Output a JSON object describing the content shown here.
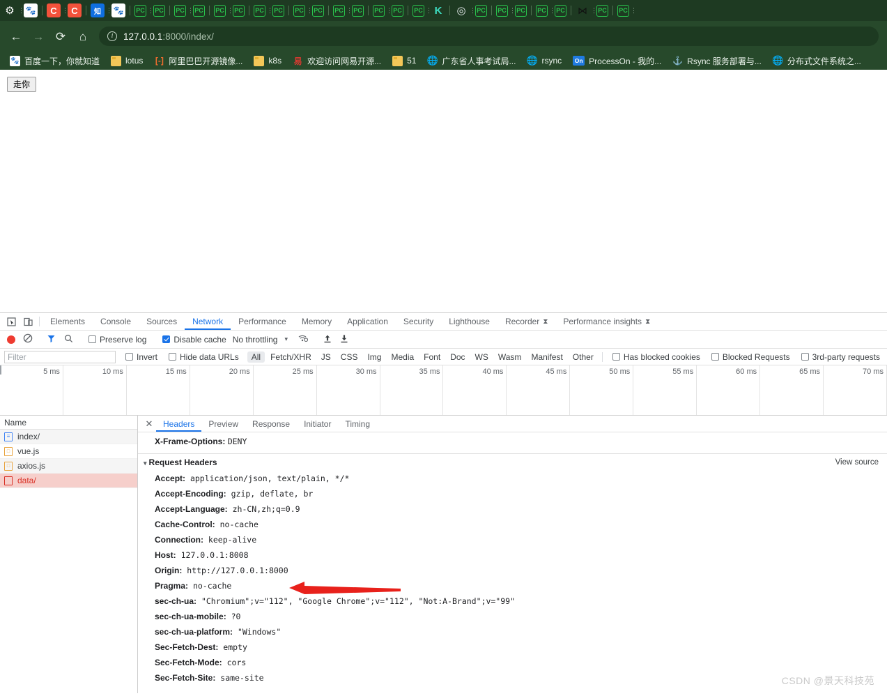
{
  "browser": {
    "tabs": [
      {
        "icon": "gear-icon",
        "glyph": "⚙",
        "cls": "ico-gear"
      },
      {
        "icon": "baidu-icon",
        "glyph": "🐾",
        "cls": "ico-baidu"
      },
      {
        "icon": "csdn-icon",
        "glyph": "C",
        "cls": "ico-c"
      },
      {
        "icon": "csdn-icon",
        "glyph": "C",
        "cls": "ico-c"
      },
      {
        "icon": "zhihu-icon",
        "glyph": "知",
        "cls": "ico-zhi"
      },
      {
        "icon": "baidu-icon",
        "glyph": "🐾",
        "cls": "ico-baidu"
      },
      {
        "icon": "pycharm-icon",
        "glyph": "PC",
        "cls": "ico-pc"
      },
      {
        "icon": "pycharm-icon",
        "glyph": "PC",
        "cls": "ico-pc"
      },
      {
        "icon": "pycharm-icon",
        "glyph": "PC",
        "cls": "ico-pc"
      },
      {
        "icon": "pycharm-icon",
        "glyph": "PC",
        "cls": "ico-pc"
      },
      {
        "icon": "pycharm-icon",
        "glyph": "PC",
        "cls": "ico-pc"
      },
      {
        "icon": "pycharm-icon",
        "glyph": "PC",
        "cls": "ico-pc"
      },
      {
        "icon": "pycharm-icon",
        "glyph": "PC",
        "cls": "ico-pc"
      },
      {
        "icon": "pycharm-icon",
        "glyph": "PC",
        "cls": "ico-pc"
      },
      {
        "icon": "pycharm-icon",
        "glyph": "PC",
        "cls": "ico-pc"
      },
      {
        "icon": "pycharm-icon",
        "glyph": "PC",
        "cls": "ico-pc"
      },
      {
        "icon": "pycharm-icon",
        "glyph": "PC",
        "cls": "ico-pc"
      },
      {
        "icon": "pycharm-icon",
        "glyph": "PC",
        "cls": "ico-pc"
      },
      {
        "icon": "pycharm-icon",
        "glyph": "PC",
        "cls": "ico-pc"
      },
      {
        "icon": "pycharm-icon",
        "glyph": "PC",
        "cls": "ico-pc"
      },
      {
        "icon": "pycharm-icon",
        "glyph": "PC",
        "cls": "ico-pc"
      },
      {
        "icon": "kafka-icon",
        "glyph": "K",
        "cls": "ico-k"
      },
      {
        "icon": "chrome-icon",
        "glyph": "◎",
        "cls": "ico-chrome"
      },
      {
        "icon": "pycharm-icon",
        "glyph": "PC",
        "cls": "ico-pc"
      },
      {
        "icon": "pycharm-icon",
        "glyph": "PC",
        "cls": "ico-pc"
      },
      {
        "icon": "pycharm-icon",
        "glyph": "PC",
        "cls": "ico-pc"
      },
      {
        "icon": "pycharm-icon",
        "glyph": "PC",
        "cls": "ico-pc"
      },
      {
        "icon": "pycharm-icon",
        "glyph": "PC",
        "cls": "ico-pc"
      },
      {
        "icon": "bowtie-icon",
        "glyph": "⋈",
        "cls": "ico-bow"
      },
      {
        "icon": "pycharm-icon",
        "glyph": "PC",
        "cls": "ico-pc"
      },
      {
        "icon": "pycharm-icon",
        "glyph": "PC",
        "cls": "ico-pc"
      }
    ],
    "nav": {
      "back": "←",
      "forward": "→",
      "reload": "⟳",
      "home": "⌂"
    },
    "omnibox": {
      "info": "i",
      "host": "127.0.0.1",
      "rest": ":8000/index/"
    },
    "bookmarks": [
      {
        "label": "百度一下，你就知道",
        "icon": "baidu-icon",
        "glyph": "🐾",
        "cls": "bmi-baidu"
      },
      {
        "label": "lotus",
        "icon": "folder-icon",
        "glyph": "",
        "cls": "bmi-folder"
      },
      {
        "label": "阿里巴巴开源镜像...",
        "icon": "alibaba-icon",
        "glyph": "[-]",
        "cls": "bmi-ali"
      },
      {
        "label": "k8s",
        "icon": "folder-icon",
        "glyph": "",
        "cls": "bmi-folder"
      },
      {
        "label": "欢迎访问网易开源...",
        "icon": "netease-icon",
        "glyph": "易",
        "cls": "bmi-163"
      },
      {
        "label": "51",
        "icon": "folder-icon",
        "glyph": "",
        "cls": "bmi-folder"
      },
      {
        "label": "广东省人事考试局...",
        "icon": "globe-icon",
        "glyph": "🌐",
        "cls": "bmi-globe"
      },
      {
        "label": "rsync",
        "icon": "globe-icon",
        "glyph": "🌐",
        "cls": "bmi-globe"
      },
      {
        "label": "ProcessOn - 我的...",
        "icon": "processon-icon",
        "glyph": "On",
        "cls": "bmi-on"
      },
      {
        "label": "Rsync 服务部署与...",
        "icon": "rsync-icon",
        "glyph": "⚓",
        "cls": "bmi-rsyncw"
      },
      {
        "label": "分布式文件系统之...",
        "icon": "globe-icon",
        "glyph": "🌐",
        "cls": "bmi-globe"
      }
    ]
  },
  "page": {
    "button_label": "走你"
  },
  "devtools": {
    "inspect_icon": "⬚",
    "device_icon": "▭",
    "tabs": [
      {
        "label": "Elements",
        "active": false,
        "warn": ""
      },
      {
        "label": "Console",
        "active": false,
        "warn": ""
      },
      {
        "label": "Sources",
        "active": false,
        "warn": ""
      },
      {
        "label": "Network",
        "active": true,
        "warn": ""
      },
      {
        "label": "Performance",
        "active": false,
        "warn": ""
      },
      {
        "label": "Memory",
        "active": false,
        "warn": ""
      },
      {
        "label": "Application",
        "active": false,
        "warn": ""
      },
      {
        "label": "Security",
        "active": false,
        "warn": ""
      },
      {
        "label": "Lighthouse",
        "active": false,
        "warn": ""
      },
      {
        "label": "Recorder",
        "active": false,
        "warn": "⧗"
      },
      {
        "label": "Performance insights",
        "active": false,
        "warn": "⧗"
      }
    ],
    "toolbar": {
      "record_title": "record",
      "clear_glyph": "⃠",
      "filter_glyph": "▼",
      "search_glyph": "⌕",
      "preserve_log": "Preserve log",
      "preserve_log_checked": false,
      "disable_cache": "Disable cache",
      "disable_cache_checked": true,
      "throttling": "No throttling",
      "caret": "▾",
      "wifi_glyph": "☰",
      "import_glyph": "↑",
      "export_glyph": "↓"
    },
    "filterbar": {
      "filter_placeholder": "Filter",
      "filter_value": "",
      "invert": "Invert",
      "invert_checked": false,
      "hide_data_urls": "Hide data URLs",
      "hide_data_urls_checked": false,
      "types": [
        "All",
        "Fetch/XHR",
        "JS",
        "CSS",
        "Img",
        "Media",
        "Font",
        "Doc",
        "WS",
        "Wasm",
        "Manifest",
        "Other"
      ],
      "active_type": "All",
      "has_blocked_cookies": "Has blocked cookies",
      "blocked_requests": "Blocked Requests",
      "third_party": "3rd-party requests"
    },
    "timeline": {
      "ticks": [
        "5 ms",
        "10 ms",
        "15 ms",
        "20 ms",
        "25 ms",
        "30 ms",
        "35 ms",
        "40 ms",
        "45 ms",
        "50 ms",
        "55 ms",
        "60 ms",
        "65 ms",
        "70 ms"
      ]
    },
    "requests": {
      "column_name": "Name",
      "rows": [
        {
          "name": "index/",
          "type": "doc",
          "selected": false
        },
        {
          "name": "vue.js",
          "type": "js",
          "selected": false
        },
        {
          "name": "axios.js",
          "type": "js",
          "selected": false
        },
        {
          "name": "data/",
          "type": "fetch",
          "selected": true
        }
      ]
    },
    "detail": {
      "close": "✕",
      "tabs": [
        {
          "label": "Headers",
          "active": true
        },
        {
          "label": "Preview",
          "active": false
        },
        {
          "label": "Response",
          "active": false
        },
        {
          "label": "Initiator",
          "active": false
        },
        {
          "label": "Timing",
          "active": false
        }
      ],
      "top_header": {
        "name": "X-Frame-Options:",
        "value": "DENY"
      },
      "section_title": "Request Headers",
      "section_triangle": "▾",
      "view_source": "View source",
      "request_headers": [
        {
          "name": "Accept:",
          "value": "application/json, text/plain, */*"
        },
        {
          "name": "Accept-Encoding:",
          "value": "gzip, deflate, br"
        },
        {
          "name": "Accept-Language:",
          "value": "zh-CN,zh;q=0.9"
        },
        {
          "name": "Cache-Control:",
          "value": "no-cache"
        },
        {
          "name": "Connection:",
          "value": "keep-alive"
        },
        {
          "name": "Host:",
          "value": "127.0.0.1:8008"
        },
        {
          "name": "Origin:",
          "value": "http://127.0.0.1:8000"
        },
        {
          "name": "Pragma:",
          "value": "no-cache"
        },
        {
          "name": "sec-ch-ua:",
          "value": "\"Chromium\";v=\"112\", \"Google Chrome\";v=\"112\", \"Not:A-Brand\";v=\"99\""
        },
        {
          "name": "sec-ch-ua-mobile:",
          "value": "?0"
        },
        {
          "name": "sec-ch-ua-platform:",
          "value": "\"Windows\""
        },
        {
          "name": "Sec-Fetch-Dest:",
          "value": "empty"
        },
        {
          "name": "Sec-Fetch-Mode:",
          "value": "cors"
        },
        {
          "name": "Sec-Fetch-Site:",
          "value": "same-site"
        }
      ]
    }
  },
  "annotation": {
    "arrow_color": "#e8211b",
    "target_header": "Origin:"
  },
  "watermark": {
    "text": "CSDN @景天科技苑"
  },
  "colors": {
    "chrome_bg": "#27492b",
    "tabstrip_bg": "#1e3a22",
    "omnibox_bg": "#1d3a21",
    "accent": "#1a73e8",
    "selected_row": "#f6cfcb",
    "record_red": "#ee3b30"
  }
}
